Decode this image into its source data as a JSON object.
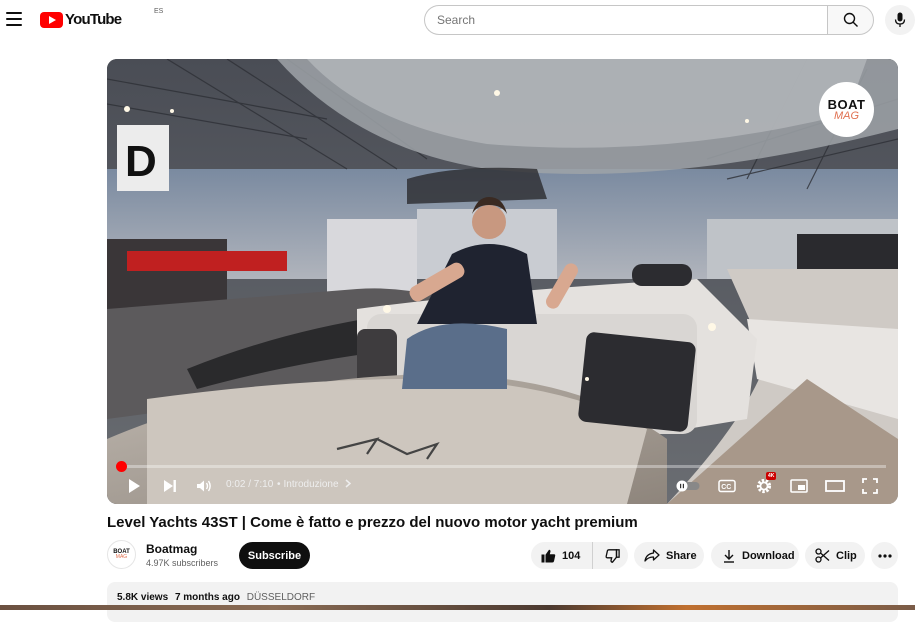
{
  "header": {
    "logo_text": "YouTube",
    "country_code": "ES",
    "search_placeholder": "Search"
  },
  "video": {
    "current_time": "0:02",
    "duration": "7:10",
    "time_display": "0:02 / 7:10",
    "chapter": "Introduzione",
    "progress_fraction": 0.003,
    "brand_badge_top": "BOAT",
    "brand_badge_bottom": "MAG",
    "settings_badge": "4K",
    "accent_color": "#ff0000"
  },
  "title": "Level Yachts 43ST | Come è fatto e prezzo del nuovo motor yacht premium",
  "channel": {
    "name": "Boatmag",
    "subscribers": "4.97K subscribers",
    "avatar_top": "BOAT",
    "avatar_bottom": "MAG",
    "subscribe_label": "Subscribe"
  },
  "actions": {
    "like_count": "104",
    "share_label": "Share",
    "download_label": "Download",
    "clip_label": "Clip"
  },
  "description": {
    "views": "5.8K views",
    "age": "7 months ago",
    "location": "DÜSSELDORF"
  }
}
